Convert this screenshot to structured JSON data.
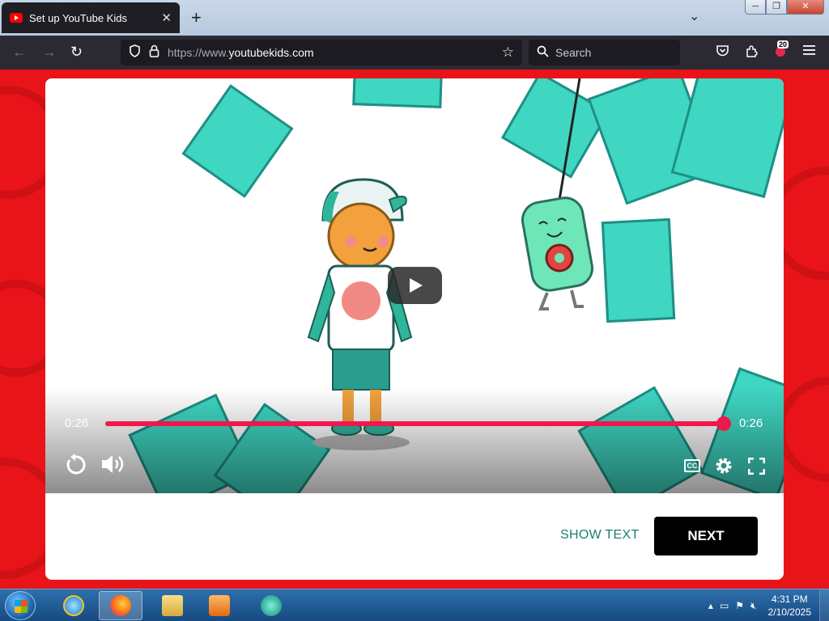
{
  "browser": {
    "tab": {
      "title": "Set up YouTube Kids",
      "close": "✕"
    },
    "new_tab": "+",
    "tabs_dropdown": "⌄",
    "window_controls": {
      "minimize": "─",
      "restore": "❐",
      "close": "✕"
    },
    "nav": {
      "back": "←",
      "forward": "→",
      "reload": "↻"
    },
    "url": {
      "prefix": "https://www.",
      "host": "youtubekids.com"
    },
    "search_placeholder": "Search",
    "extensions_badge": "20",
    "icons": {
      "shield": "shield-icon",
      "lock": "lock-icon",
      "star": "star-icon",
      "pocket": "pocket-icon",
      "extensions": "puzzle-icon",
      "menu": "hamburger-menu-icon"
    }
  },
  "video": {
    "time_current": "0:26",
    "time_total": "0:26",
    "progress": 1.0,
    "captions_label": "CC"
  },
  "actions": {
    "show_text": "SHOW TEXT",
    "next": "NEXT"
  },
  "taskbar": {
    "clock_time": "4:31 PM",
    "clock_date": "2/10/2025",
    "apps": [
      "internet-explorer",
      "firefox",
      "file-explorer",
      "media-player",
      "browser-app"
    ]
  },
  "colors": {
    "page_bg": "#e8141a",
    "progress": "#f0174d",
    "accent_teal": "#3fd6c2",
    "show_text": "#1a7f6e",
    "next_bg": "#000000"
  }
}
